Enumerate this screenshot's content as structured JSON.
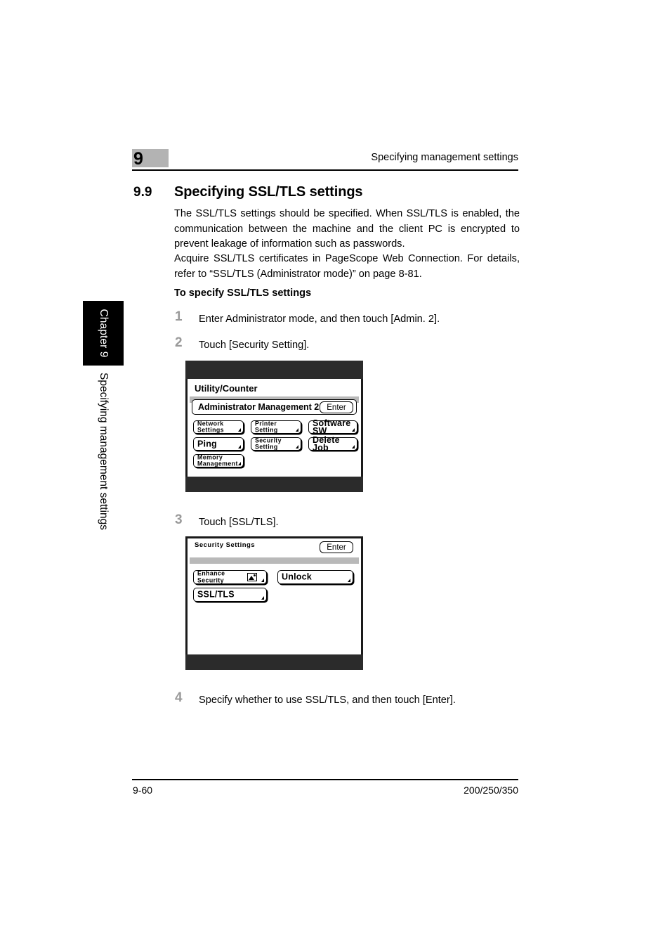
{
  "sidebar": {
    "chapter_tab": "Chapter 9",
    "vertical_title": "Specifying management settings"
  },
  "header": {
    "chapter_number": "9",
    "running_title": "Specifying management settings"
  },
  "section": {
    "number": "9.9",
    "title": "Specifying SSL/TLS settings",
    "paragraph_1": "The SSL/TLS settings should be specified. When SSL/TLS is enabled, the communication between the machine and the client PC is encrypted to prevent leakage of information such as passwords.",
    "paragraph_2": "Acquire SSL/TLS certificates in PageScope Web Connection. For details, refer to “SSL/TLS (Administrator mode)” on page 8-81.",
    "subheading": "To specify SSL/TLS settings"
  },
  "steps": [
    {
      "number": "1",
      "text": "Enter Administrator mode, and then touch [Admin. 2]."
    },
    {
      "number": "2",
      "text": "Touch [Security Setting]."
    },
    {
      "number": "3",
      "text": "Touch [SSL/TLS]."
    },
    {
      "number": "4",
      "text": "Specify whether to use SSL/TLS, and then touch [Enter]."
    }
  ],
  "panel_one": {
    "screen_title": "Utility/Counter",
    "titlebar_label": "Administrator Management 2",
    "enter_label": "Enter",
    "buttons": [
      {
        "label": "Network\nSettings",
        "style": "two-line"
      },
      {
        "label": "Printer\nSetting",
        "style": "two-line"
      },
      {
        "label": "Software SW",
        "style": "big"
      },
      {
        "label": "Ping",
        "style": "big"
      },
      {
        "label": "Security\nSetting",
        "style": "two-line"
      },
      {
        "label": "Delete Job",
        "style": "big"
      },
      {
        "label": "Memory\nManagement",
        "style": "two-line"
      }
    ]
  },
  "panel_two": {
    "screen_title": "Security\nSettings",
    "enter_label": "Enter",
    "buttons": [
      {
        "label": "Enhance\nSecurity",
        "style": "two-line",
        "icon": "image-glyph-icon"
      },
      {
        "label": "Unlock",
        "style": "big"
      },
      {
        "label": "SSL/TLS",
        "style": "big"
      }
    ]
  },
  "footer": {
    "page_number": "9-60",
    "model_numbers": "200/250/350"
  }
}
